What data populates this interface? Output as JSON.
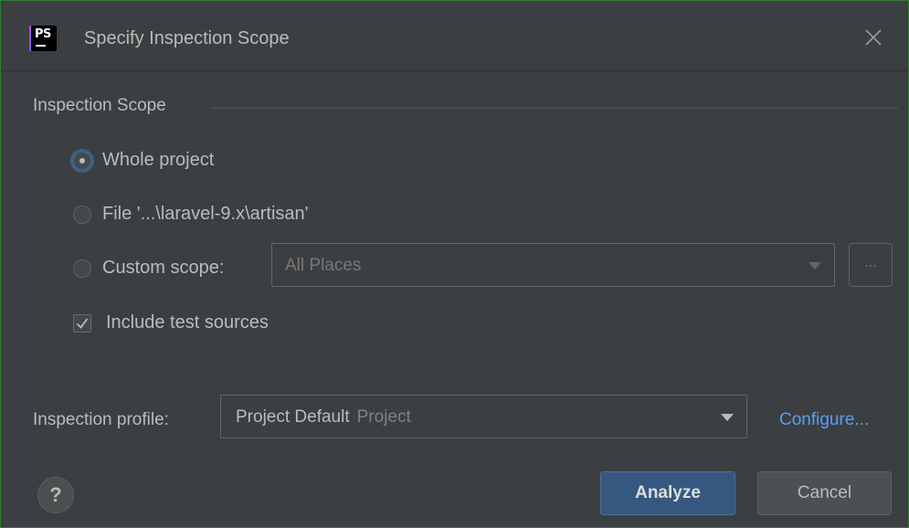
{
  "window": {
    "title": "Specify Inspection Scope",
    "app_icon": "phpstorm-icon",
    "app_icon_text": "PS"
  },
  "scope": {
    "section_title": "Inspection Scope",
    "options": [
      {
        "label": "Whole project",
        "checked": true
      },
      {
        "label": "File '...\\laravel-9.x\\artisan'",
        "checked": false
      },
      {
        "label": "Custom scope:",
        "checked": false
      }
    ],
    "custom_scope_value": "All Places",
    "browse_label": "...",
    "include_tests": {
      "label": "Include test sources",
      "checked": true
    }
  },
  "profile": {
    "label": "Inspection profile:",
    "name": "Project Default",
    "sub": "Project",
    "configure_label": "Configure..."
  },
  "footer": {
    "help_label": "?",
    "analyze_label": "Analyze",
    "cancel_label": "Cancel"
  },
  "colors": {
    "background": "#3c3f41",
    "accent": "#365880",
    "link": "#589df6",
    "border": "#2f7a2f"
  }
}
